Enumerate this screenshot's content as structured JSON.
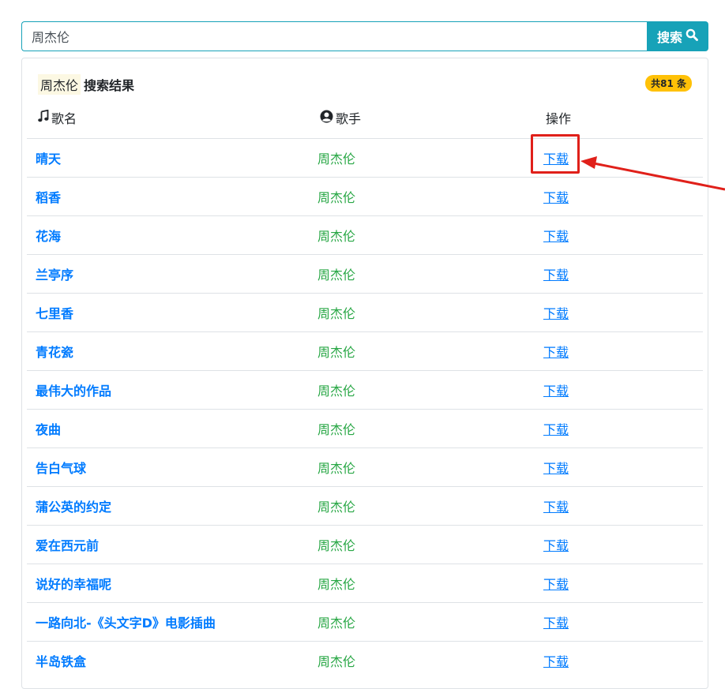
{
  "search": {
    "value": "周杰伦",
    "button_label": "搜索"
  },
  "results": {
    "keyword": "周杰伦",
    "title": "搜索结果",
    "count_badge": "共81 条"
  },
  "columns": {
    "song": "歌名",
    "artist": "歌手",
    "action": "操作"
  },
  "rows": [
    {
      "song": "晴天",
      "artist": "周杰伦",
      "action": "下载"
    },
    {
      "song": "稻香",
      "artist": "周杰伦",
      "action": "下载"
    },
    {
      "song": "花海",
      "artist": "周杰伦",
      "action": "下载"
    },
    {
      "song": "兰亭序",
      "artist": "周杰伦",
      "action": "下载"
    },
    {
      "song": "七里香",
      "artist": "周杰伦",
      "action": "下载"
    },
    {
      "song": "青花瓷",
      "artist": "周杰伦",
      "action": "下载"
    },
    {
      "song": "最伟大的作品",
      "artist": "周杰伦",
      "action": "下载"
    },
    {
      "song": "夜曲",
      "artist": "周杰伦",
      "action": "下载"
    },
    {
      "song": "告白气球",
      "artist": "周杰伦",
      "action": "下载"
    },
    {
      "song": "蒲公英的约定",
      "artist": "周杰伦",
      "action": "下载"
    },
    {
      "song": "爱在西元前",
      "artist": "周杰伦",
      "action": "下载"
    },
    {
      "song": "说好的幸福呢",
      "artist": "周杰伦",
      "action": "下载"
    },
    {
      "song": "一路向北-《头文字D》电影插曲",
      "artist": "周杰伦",
      "action": "下载"
    },
    {
      "song": "半岛铁盒",
      "artist": "周杰伦",
      "action": "下载"
    }
  ],
  "icons": {
    "search_button": "search-icon",
    "song_column": "music-note-icon",
    "artist_column": "user-circle-icon"
  },
  "colors": {
    "accent": "#17a2b8",
    "link": "#007bff",
    "artist": "#28a745",
    "badge": "#ffc107",
    "annotation": "#e0201a"
  }
}
